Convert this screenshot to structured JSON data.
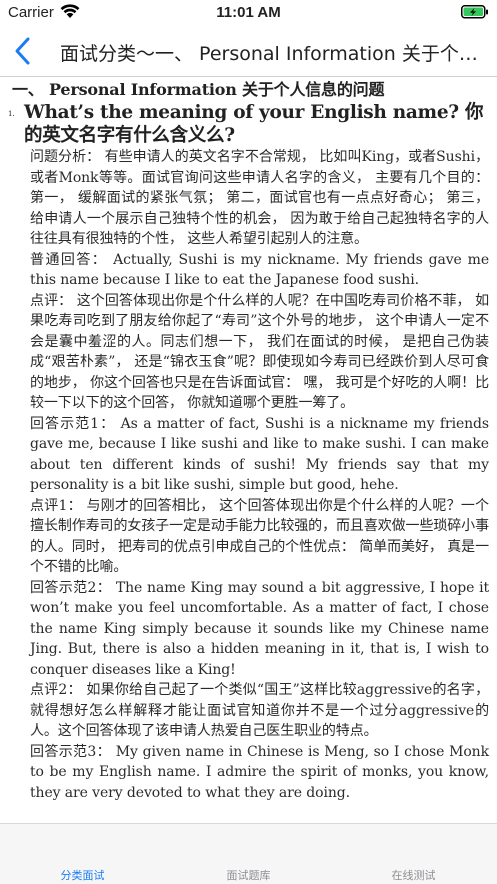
{
  "status_bar": {
    "carrier": "Carrier",
    "time": "11:01 AM"
  },
  "nav": {
    "title": "面试分类～一、 Personal Information 关于个人信息的问题"
  },
  "content": {
    "section_title": "一、 Personal Information 关于个人信息的问题",
    "question_number": "1.",
    "question_text": "What’s the meaning of your English name? 你的英文名字有什么含义么?",
    "paragraphs": [
      "问题分析： 有些申请人的英文名字不合常规， 比如叫King，或者Sushi， 或者Monk等等。面试官询问这些申请人名字的含义， 主要有几个目的： 第一， 缓解面试的紧张气氛； 第二，面试官也有一点点好奇心； 第三， 给申请人一个展示自己独特个性的机会， 因为敢于给自己起独特名字的人往往具有很独特的个性， 这些人希望引起别人的注意。",
      "普通回答： Actually, Sushi is my nickname. My friends gave me this name because I like to eat the Japanese food sushi.",
      "点评： 这个回答体现出你是个什么样的人呢？在中国吃寿司价格不菲， 如果吃寿司吃到了朋友给你起了“寿司”这个外号的地步， 这个申请人一定不会是囊中羞涩的人。同志们想一下， 我们在面试的时候， 是把自己伪装成“艰苦朴素”， 还是“锦衣玉食”呢？即使现如今寿司已经跌价到人尽可食的地步， 你这个回答也只是在告诉面试官： 嘿， 我可是个好吃的人啊！比较一下以下的这个回答， 你就知道哪个更胜一筹了。",
      "回答示范1： As a matter of fact, Sushi is a nickname my friends gave me, because I like sushi and like to make sushi. I can make about ten different kinds of sushi! My friends say that my personality is a bit like sushi, simple but good, hehe.",
      "点评1： 与刚才的回答相比， 这个回答体现出你是个什么样的人呢？一个擅长制作寿司的女孩子一定是动手能力比较强的，而且喜欢做一些琐碎小事的人。同时， 把寿司的优点引申成自己的个性优点： 简单而美好， 真是一个不错的比喻。",
      "回答示范2： The name King may sound a bit aggressive, I hope it won’t make you feel uncomfortable. As a matter of fact, I chose the name King simply because it sounds like my Chinese name Jing. But, there is also a hidden meaning in it, that is, I wish to conquer diseases like a King!",
      "点评2： 如果你给自己起了一个类似“国王”这样比较aggressive的名字， 就得想好怎么样解释才能让面试官知道你并不是一个过分aggressive的人。这个回答体现了该申请人热爱自己医生职业的特点。",
      "回答示范3： My given name in Chinese is Meng, so I chose Monk to be my English name. I admire the spirit of monks, you know, they are very devoted to what they are doing."
    ]
  },
  "tabs": [
    {
      "label": "分类面试",
      "active": true
    },
    {
      "label": "面试题库",
      "active": false
    },
    {
      "label": "在线测试",
      "active": false
    }
  ],
  "colors": {
    "accent": "#1a7cf5",
    "battery": "#34c759",
    "inactive_tab": "#8e8e93"
  }
}
